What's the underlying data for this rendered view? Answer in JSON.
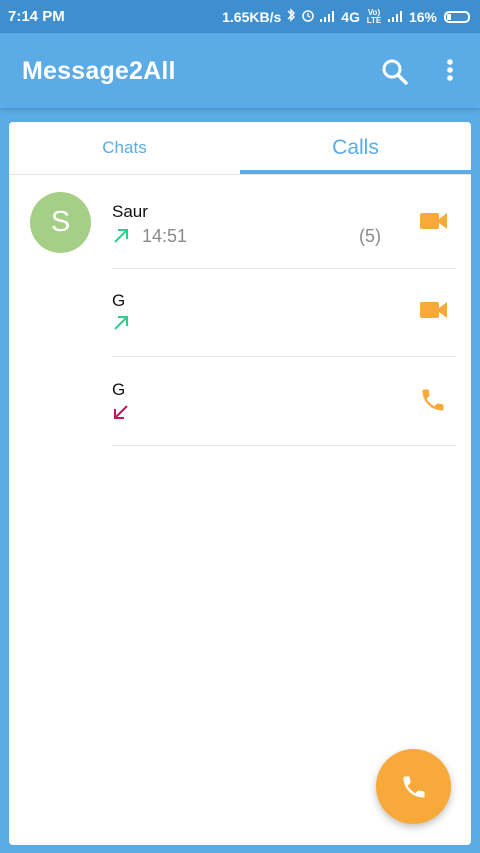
{
  "status_bar": {
    "time": "7:14 PM",
    "network_speed": "1.65KB/s",
    "network_type": "4G",
    "volte_label": "Vo) LTE",
    "battery": "16%"
  },
  "app_bar": {
    "title": "Message2All",
    "icons": [
      "search-icon",
      "more-vertical-icon"
    ]
  },
  "tabs": [
    {
      "label": "Chats",
      "selected": false
    },
    {
      "label": "Calls",
      "selected": true
    }
  ],
  "calls": [
    {
      "avatar_letter": "S",
      "name": "Saur",
      "direction": "outgoing",
      "time": "14:51",
      "count": "(5)",
      "type": "video"
    },
    {
      "avatar_letter": "",
      "name": "G",
      "direction": "outgoing",
      "time": "",
      "count": "",
      "type": "video"
    },
    {
      "avatar_letter": "",
      "name": "G",
      "direction": "incoming",
      "time": "",
      "count": "",
      "type": "voice"
    }
  ],
  "colors": {
    "primary": "#5aabe6",
    "status_bar": "#3d8fd0",
    "accent": "#f7a93a",
    "avatar": "#a5cf86",
    "outgoing_arrow": "#2ecc8f",
    "incoming_arrow": "#c2185b"
  },
  "fab": {
    "icon": "phone-icon"
  }
}
